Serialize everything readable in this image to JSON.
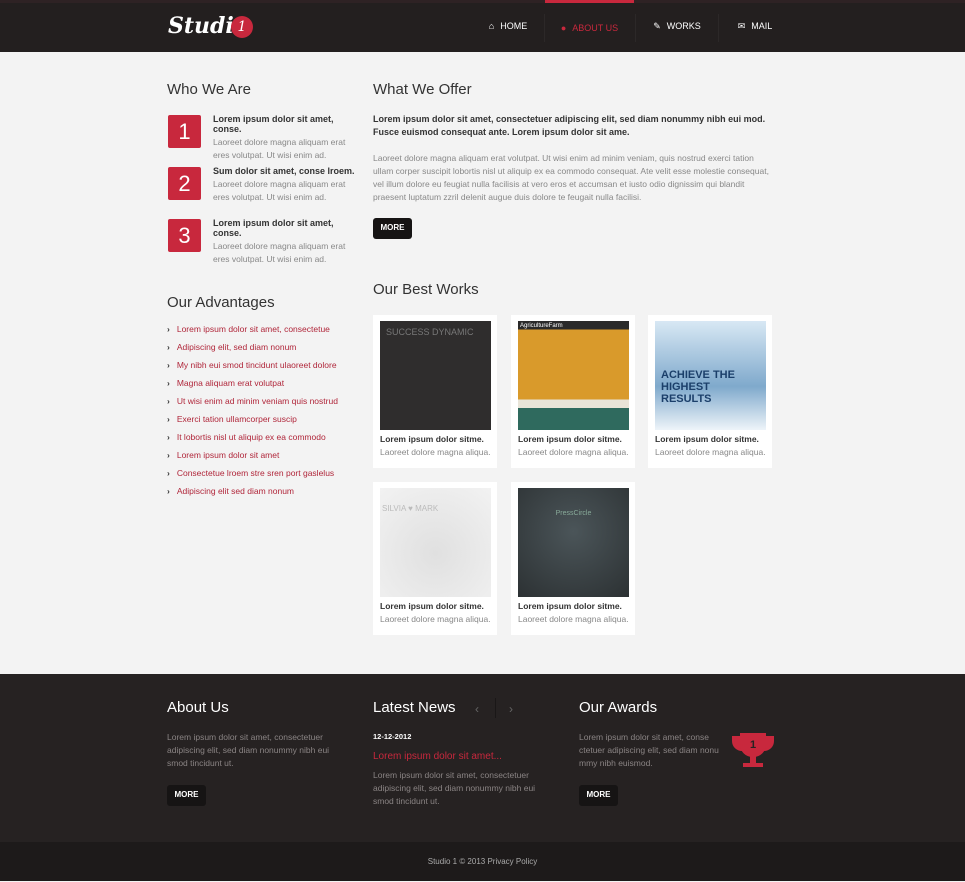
{
  "header": {
    "logo": "Studio",
    "logo_badge": "1",
    "nav": [
      {
        "label": "HOME",
        "icon": "home-icon"
      },
      {
        "label": "ABOUT US",
        "icon": "user-icon",
        "active": true
      },
      {
        "label": "WORKS",
        "icon": "pencil-icon"
      },
      {
        "label": "MAIL",
        "icon": "mail-icon"
      }
    ]
  },
  "who": {
    "title": "Who We Are",
    "items": [
      {
        "num": "1",
        "title": "Lorem ipsum dolor sit amet, conse.",
        "desc": "Laoreet dolore magna aliquam erat eres volutpat. Ut wisi enim ad."
      },
      {
        "num": "2",
        "title": "Sum dolor sit amet, conse lroem.",
        "desc": "Laoreet dolore magna aliquam erat eres volutpat. Ut wisi enim ad."
      },
      {
        "num": "3",
        "title": "Lorem ipsum dolor sit amet, conse.",
        "desc": "Laoreet dolore magna aliquam erat eres volutpat. Ut wisi enim ad."
      }
    ]
  },
  "offer": {
    "title": "What We Offer",
    "lead": "Lorem ipsum dolor sit amet, consectetuer adipiscing elit, sed diam nonummy nibh eui mod. Fusce euismod consequat ante. Lorem ipsum dolor sit ame.",
    "body": "Laoreet dolore magna aliquam erat volutpat. Ut wisi enim ad minim veniam, quis nostrud exerci tation ullam corper suscipit lobortis nisl ut aliquip ex ea commodo consequat. Ate velit esse molestie consequat, vel illum dolore eu feugiat nulla facilisis at vero eros et accumsan et iusto odio dignissim qui blandit praesent luptatum zzril delenit augue duis dolore te feugait nulla facilisi.",
    "more": "MORE"
  },
  "advantages": {
    "title": "Our Advantages",
    "items": [
      "Lorem ipsum dolor sit amet, consectetue",
      "Adipiscing elit, sed diam nonum",
      "My nibh eui smod tincidunt ulaoreet dolore",
      "Magna aliquam erat volutpat",
      "Ut wisi enim ad minim veniam quis nostrud",
      "Exerci tation ullamcorper suscip",
      "It lobortis nisl ut aliquip ex ea commodo",
      "Lorem ipsum dolor sit amet",
      "Consectetue lroem stre sren port gaslelus",
      "Adipiscing elit sed diam nonum"
    ]
  },
  "works": {
    "title": "Our Best Works",
    "items": [
      {
        "title": "Lorem ipsum dolor sitme.",
        "desc": "Laoreet dolore magna aliqua.",
        "thumb_text": "SUCCESS DYNAMIC"
      },
      {
        "title": "Lorem ipsum dolor sitme.",
        "desc": "Laoreet dolore magna aliqua.",
        "thumb_text": "AgricultureFarm"
      },
      {
        "title": "Lorem ipsum dolor sitme.",
        "desc": "Laoreet dolore magna aliqua.",
        "thumb_text": "ACHIEVE THE HIGHEST RESULTS"
      },
      {
        "title": "Lorem ipsum dolor sitme.",
        "desc": "Laoreet dolore magna aliqua.",
        "thumb_text": "SILVIA ♥ MARK"
      },
      {
        "title": "Lorem ipsum dolor sitme.",
        "desc": "Laoreet dolore magna aliqua.",
        "thumb_text": "PressCircle"
      }
    ]
  },
  "footer": {
    "about": {
      "title": "About Us",
      "text": "Lorem ipsum dolor sit amet, consectetuer adipiscing elit, sed diam nonummy nibh eui smod tincidunt ut.",
      "more": "MORE"
    },
    "news": {
      "title": "Latest News",
      "date": "12-12-2012",
      "link": "Lorem ipsum dolor sit amet...",
      "text": "Lorem ipsum dolor sit amet, consectetuer adipiscing elit, sed diam nonummy nibh eui smod tincidunt ut."
    },
    "awards": {
      "title": "Our Awards",
      "text": "Lorem ipsum dolor sit amet, conse ctetuer adipiscing elit, sed diam nonu mmy nibh euismod.",
      "more": "MORE",
      "trophy_num": "1"
    },
    "copyright": "Studio 1 © 2013 Privacy Policy"
  },
  "colors": {
    "accent": "#c8283d",
    "dark": "#231f1f"
  }
}
